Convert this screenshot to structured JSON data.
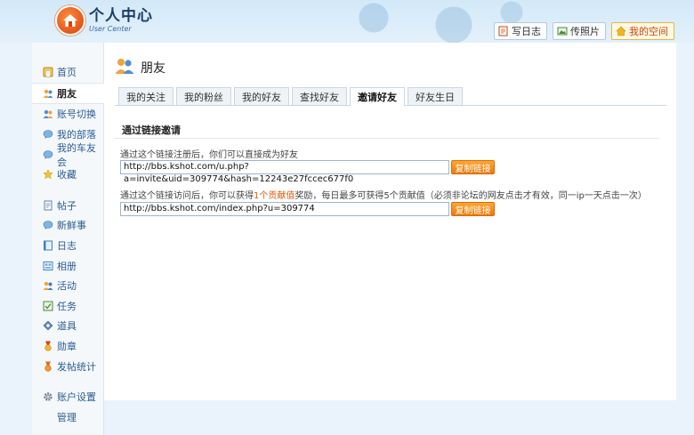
{
  "header": {
    "logo_cn": "个人中心",
    "logo_en": "User Center",
    "buttons": [
      {
        "label": "写日志",
        "icon": "pencil-icon"
      },
      {
        "label": "传照片",
        "icon": "photo-icon"
      },
      {
        "label": "我的空间",
        "icon": "home-icon",
        "highlight": true
      }
    ]
  },
  "sidebar": {
    "items": [
      {
        "label": "首页",
        "icon": "home-icon"
      },
      {
        "label": "朋友",
        "icon": "friends-icon",
        "active": true
      },
      {
        "label": "账号切换",
        "icon": "switch-account-icon"
      },
      {
        "label": "我的部落",
        "icon": "chat-bubble-icon"
      },
      {
        "label": "我的车友会",
        "icon": "chat-bubble-icon"
      },
      {
        "label": "收藏",
        "icon": "star-icon"
      },
      {
        "label": "帖子",
        "icon": "document-icon"
      },
      {
        "label": "新鲜事",
        "icon": "chat-bubble-icon"
      },
      {
        "label": "日志",
        "icon": "journal-icon"
      },
      {
        "label": "相册",
        "icon": "album-icon"
      },
      {
        "label": "活动",
        "icon": "activity-icon"
      },
      {
        "label": "任务",
        "icon": "task-icon"
      },
      {
        "label": "道具",
        "icon": "tool-icon"
      },
      {
        "label": "勋章",
        "icon": "medal-icon"
      },
      {
        "label": "发帖统计",
        "icon": "stats-icon"
      },
      {
        "label": "账户设置",
        "icon": "gear-icon"
      },
      {
        "label": "管理",
        "icon": ""
      }
    ]
  },
  "main": {
    "title": "朋友",
    "tabs": [
      "我的关注",
      "我的粉丝",
      "我的好友",
      "查找好友",
      "邀请好友",
      "好友生日"
    ],
    "active_tab": 4,
    "section_title": "通过链接邀请",
    "invite1": {
      "desc": "通过这个链接注册后，你们可以直接成为好友",
      "link": "http://bbs.kshot.com/u.php?a=invite&uid=309774&hash=12243e27fccec677f0",
      "button": "复制链接"
    },
    "invite2": {
      "desc_prefix": "通过这个链接访问后，你可以获得",
      "desc_em": "1个贡献值",
      "desc_suffix": "奖励，每日最多可获得5个贡献值（必须非论坛的网友点击才有效，同一ip一天点击一次）",
      "link": "http://bbs.kshot.com/index.php?u=309774",
      "button": "复制链接"
    }
  },
  "colors": {
    "accent_orange": "#ec7a0b",
    "link_blue": "#2a5c92",
    "highlight_red": "#e05a0a"
  }
}
